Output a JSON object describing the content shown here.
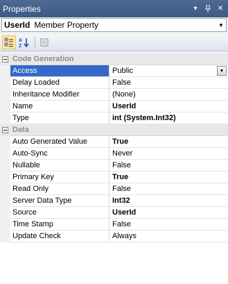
{
  "window": {
    "title": "Properties"
  },
  "object_selector": {
    "name": "UserId",
    "type": "Member Property"
  },
  "toolbar": {
    "buttons": [
      "categorized-view-icon",
      "alphabetical-sort-icon",
      "property-pages-icon"
    ]
  },
  "categories": [
    {
      "label": "Code Generation",
      "properties": [
        {
          "name": "Access",
          "value": "Public",
          "bold": false,
          "selected": true
        },
        {
          "name": "Delay Loaded",
          "value": "False",
          "bold": false
        },
        {
          "name": "Inheritance Modifier",
          "value": "(None)",
          "bold": false
        },
        {
          "name": "Name",
          "value": "UserId",
          "bold": true
        },
        {
          "name": "Type",
          "value": "int (System.Int32)",
          "bold": true
        }
      ]
    },
    {
      "label": "Data",
      "properties": [
        {
          "name": "Auto Generated Value",
          "value": "True",
          "bold": true
        },
        {
          "name": "Auto-Sync",
          "value": "Never",
          "bold": false
        },
        {
          "name": "Nullable",
          "value": "False",
          "bold": false
        },
        {
          "name": "Primary Key",
          "value": "True",
          "bold": true
        },
        {
          "name": "Read Only",
          "value": "False",
          "bold": false
        },
        {
          "name": "Server Data Type",
          "value": "Int32",
          "bold": true
        },
        {
          "name": "Source",
          "value": "UserId",
          "bold": true
        },
        {
          "name": "Time Stamp",
          "value": "False",
          "bold": false
        },
        {
          "name": "Update Check",
          "value": "Always",
          "bold": false
        }
      ]
    }
  ]
}
